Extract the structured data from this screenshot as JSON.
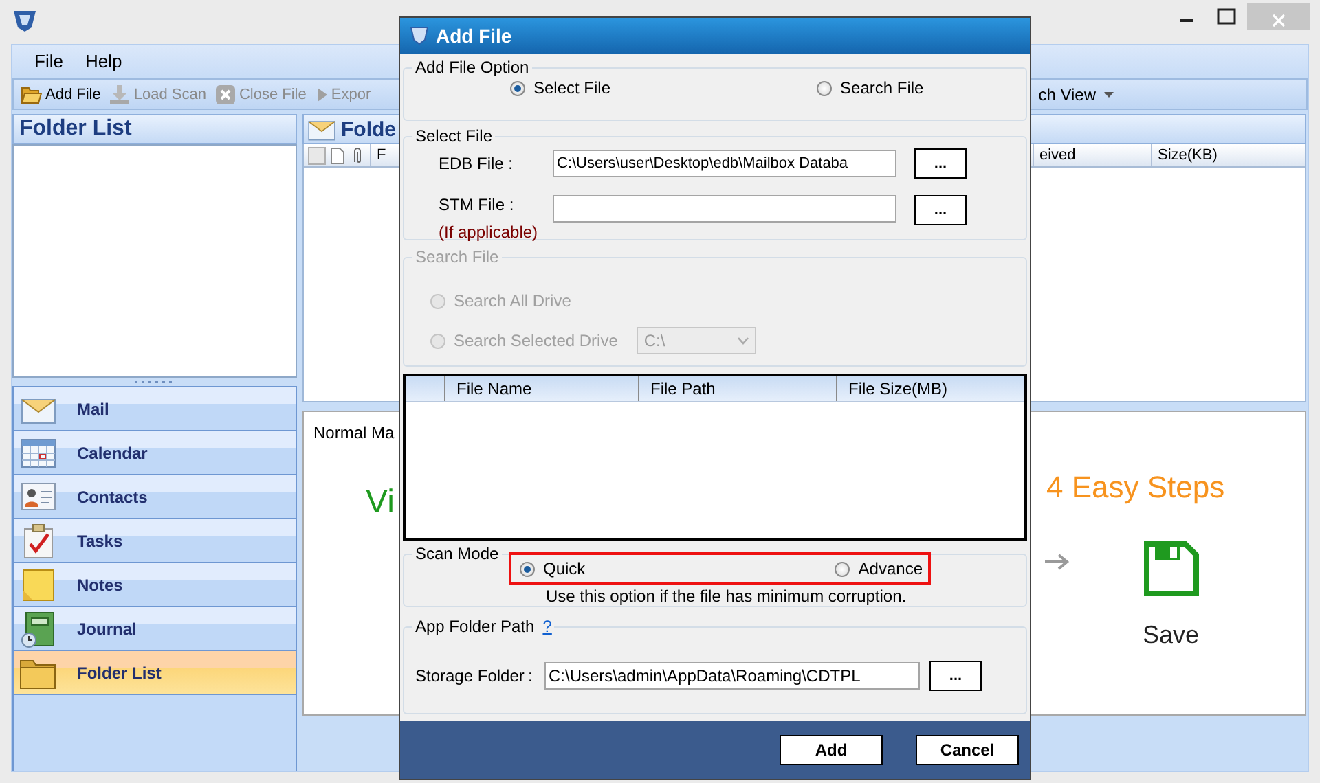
{
  "menu": [
    "File",
    "Help"
  ],
  "toolbar": [
    {
      "label": "Add File",
      "kind": "open",
      "disabled": false
    },
    {
      "label": "Load Scan",
      "kind": "load",
      "disabled": true
    },
    {
      "label": "Close File",
      "kind": "close",
      "disabled": true
    },
    {
      "label": "Expor",
      "kind": "export",
      "disabled": true
    }
  ],
  "toolbar_right": {
    "label": "ch View"
  },
  "folder_pane": {
    "title": "Folder List"
  },
  "nav": [
    {
      "label": "Mail",
      "kind": "mail",
      "selected": false
    },
    {
      "label": "Calendar",
      "kind": "calendar",
      "selected": false
    },
    {
      "label": "Contacts",
      "kind": "contacts",
      "selected": false
    },
    {
      "label": "Tasks",
      "kind": "tasks",
      "selected": false
    },
    {
      "label": "Notes",
      "kind": "notes",
      "selected": false
    },
    {
      "label": "Journal",
      "kind": "journal",
      "selected": false
    },
    {
      "label": "Folder List",
      "kind": "folder",
      "selected": true
    }
  ],
  "content": {
    "title": "Folde",
    "select_all": {
      "checked": false
    },
    "columns_left": [
      "F"
    ],
    "columns_right": [
      "eived",
      "Size(KB)"
    ],
    "preview": {
      "tab": "Normal Ma",
      "heading_left": "Vi",
      "heading_right": "4 Easy Steps",
      "step": "Save"
    }
  },
  "dialog": {
    "title": "Add File",
    "add_file_option": {
      "legend": "Add File Option",
      "options": [
        {
          "label": "Select File",
          "selected": true
        },
        {
          "label": "Search File",
          "selected": false
        }
      ]
    },
    "select_file": {
      "legend": "Select File",
      "edb_label": "EDB File :",
      "edb_value": "C:\\Users\\user\\Desktop\\edb\\Mailbox Databa",
      "stm_label": "STM File :",
      "stm_note": "(If applicable)",
      "browse": [
        "...",
        "..."
      ]
    },
    "search_file": {
      "legend": "Search File",
      "disabled": true,
      "options": [
        {
          "label": "Search All Drive",
          "selected": false
        },
        {
          "label": "Search Selected Drive",
          "selected": false
        }
      ],
      "drive": "C:\\"
    },
    "file_table": {
      "columns": [
        "File Name",
        "File Path",
        "File Size(MB)"
      ]
    },
    "scan_mode": {
      "legend": "Scan Mode",
      "options": [
        {
          "label": "Quick",
          "selected": true
        },
        {
          "label": "Advance",
          "selected": false
        }
      ],
      "hint": "Use this option if the file has minimum corruption."
    },
    "app_folder": {
      "legend": "App Folder Path",
      "help": "?",
      "label": "Storage Folder",
      "colon": ":",
      "value": "C:\\Users\\admin\\AppData\\Roaming\\CDTPL",
      "browse": "..."
    },
    "buttons": [
      "Add",
      "Cancel"
    ]
  }
}
